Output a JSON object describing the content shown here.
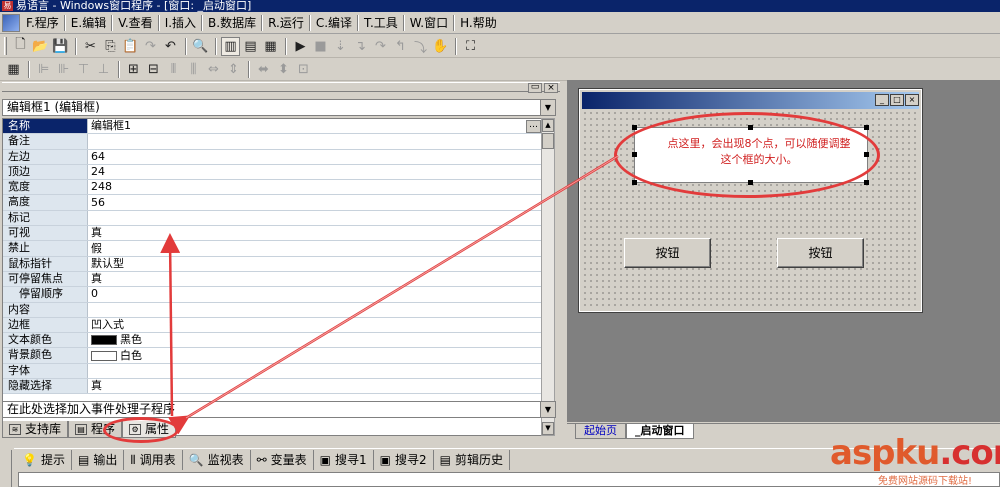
{
  "window": {
    "title": "易语言 - Windows窗口程序 - [窗口: _启动窗口]"
  },
  "menu": [
    "F.程序",
    "E.编辑",
    "V.查看",
    "I.插入",
    "B.数据库",
    "R.运行",
    "C.编译",
    "T.工具",
    "W.窗口",
    "H.帮助"
  ],
  "properties": {
    "object_combo": "编辑框1 (编辑框)",
    "rows": [
      {
        "key": "名称",
        "value": "编辑框1",
        "selected": true
      },
      {
        "key": "备注",
        "value": ""
      },
      {
        "key": "左边",
        "value": "64"
      },
      {
        "key": "顶边",
        "value": "24"
      },
      {
        "key": "宽度",
        "value": "248"
      },
      {
        "key": "高度",
        "value": "56"
      },
      {
        "key": "标记",
        "value": ""
      },
      {
        "key": "可视",
        "value": "真"
      },
      {
        "key": "禁止",
        "value": "假"
      },
      {
        "key": "鼠标指针",
        "value": "默认型"
      },
      {
        "key": "可停留焦点",
        "value": "真"
      },
      {
        "key": "停留顺序",
        "value": "0",
        "indent": true
      },
      {
        "key": "内容",
        "value": ""
      },
      {
        "key": "边框",
        "value": "凹入式"
      },
      {
        "key": "文本颜色",
        "value": "黑色",
        "swatch": "#000000"
      },
      {
        "key": "背景颜色",
        "value": "白色",
        "swatch": "#ffffff"
      },
      {
        "key": "字体",
        "value": ""
      },
      {
        "key": "隐藏选择",
        "value": "真"
      }
    ],
    "event_combo": "在此处选择加入事件处理子程序"
  },
  "panel_tabs": [
    "支持库",
    "程序",
    "属性"
  ],
  "design_tabs": [
    "起始页",
    "_启动窗口"
  ],
  "form": {
    "buttons": [
      "按钮",
      "按钮"
    ],
    "annotation": "点这里，会出现8个点，可以随便调整这个框的大小。"
  },
  "output_tabs": [
    "提示",
    "输出",
    "调用表",
    "监视表",
    "变量表",
    "搜寻1",
    "搜寻2",
    "剪辑历史"
  ],
  "watermark": {
    "brand": "aspku",
    "suffix": ".com",
    "sub": "免费网站源码下载站!"
  },
  "colors": {
    "highlight": "#e23b3b",
    "selection": "#0a246a"
  }
}
